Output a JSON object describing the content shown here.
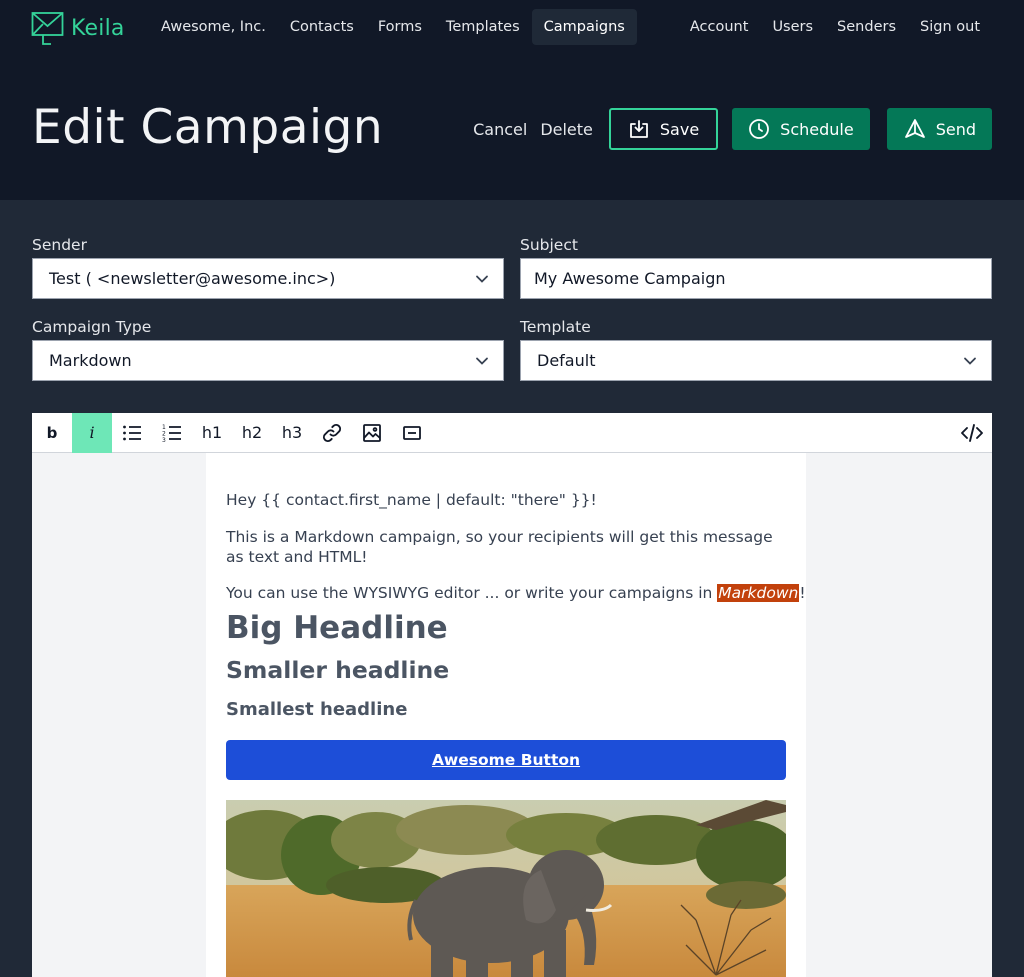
{
  "brand": {
    "name": "Keila",
    "accent": "#34d399"
  },
  "nav": {
    "left": [
      "Awesome, Inc.",
      "Contacts",
      "Forms",
      "Templates",
      "Campaigns"
    ],
    "active": "Campaigns",
    "right": [
      "Account",
      "Users",
      "Senders",
      "Sign out"
    ]
  },
  "header": {
    "title": "Edit Campaign",
    "cancel": "Cancel",
    "delete": "Delete",
    "save": "Save",
    "schedule": "Schedule",
    "send": "Send"
  },
  "form": {
    "sender": {
      "label": "Sender",
      "value": "Test ( <newsletter@awesome.inc>)"
    },
    "subject": {
      "label": "Subject",
      "value": "My Awesome Campaign"
    },
    "campaign_type": {
      "label": "Campaign Type",
      "value": "Markdown"
    },
    "template": {
      "label": "Template",
      "value": "Default"
    }
  },
  "toolbar": {
    "bold": "b",
    "italic": "i",
    "h1": "h1",
    "h2": "h2",
    "h3": "h3",
    "active": "italic"
  },
  "editor": {
    "greeting": "Hey {{ contact.first_name | default: \"there\" }}!",
    "intro": "This is a Markdown campaign, so your recipients will get this message as text and HTML!",
    "wysiwyg_prefix": "You can use the WYSIWYG editor ... or write your campaigns in ",
    "wysiwyg_highlight": "Markdown",
    "wysiwyg_suffix": "!",
    "big_headline": "Big Headline",
    "smaller_headline": "Smaller headline",
    "smallest_headline": "Smallest headline",
    "button_label": "Awesome Button"
  }
}
